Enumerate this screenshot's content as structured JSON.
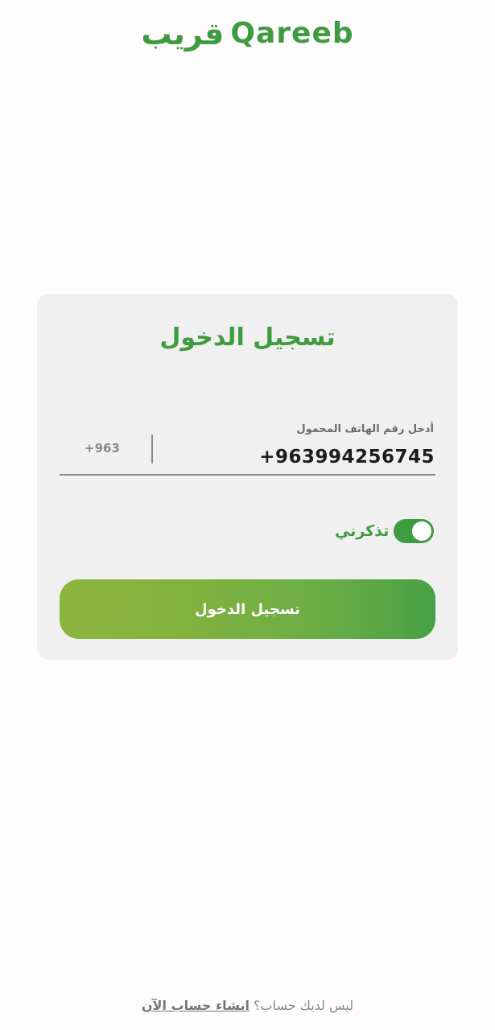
{
  "logo": {
    "arabic": "قريب",
    "latin": "Qareeb"
  },
  "login_card": {
    "title": "تسجيل الدخول",
    "phone_label": "أدخل رقم الهاتف المحمول",
    "phone_value": "+963994256745",
    "country_code": "+963",
    "remember_label": "تذكرني",
    "remember_enabled": true,
    "submit_label": "تسجيل الدخول"
  },
  "footer": {
    "question": "ليس لديك حساب؟",
    "signup_link": "انشاء حساب الآن"
  },
  "colors": {
    "brand_green": "#3f9b40",
    "card_background": "#eff0ef",
    "button_gradient_start": "#8cb53e",
    "button_gradient_end": "#48a045"
  }
}
